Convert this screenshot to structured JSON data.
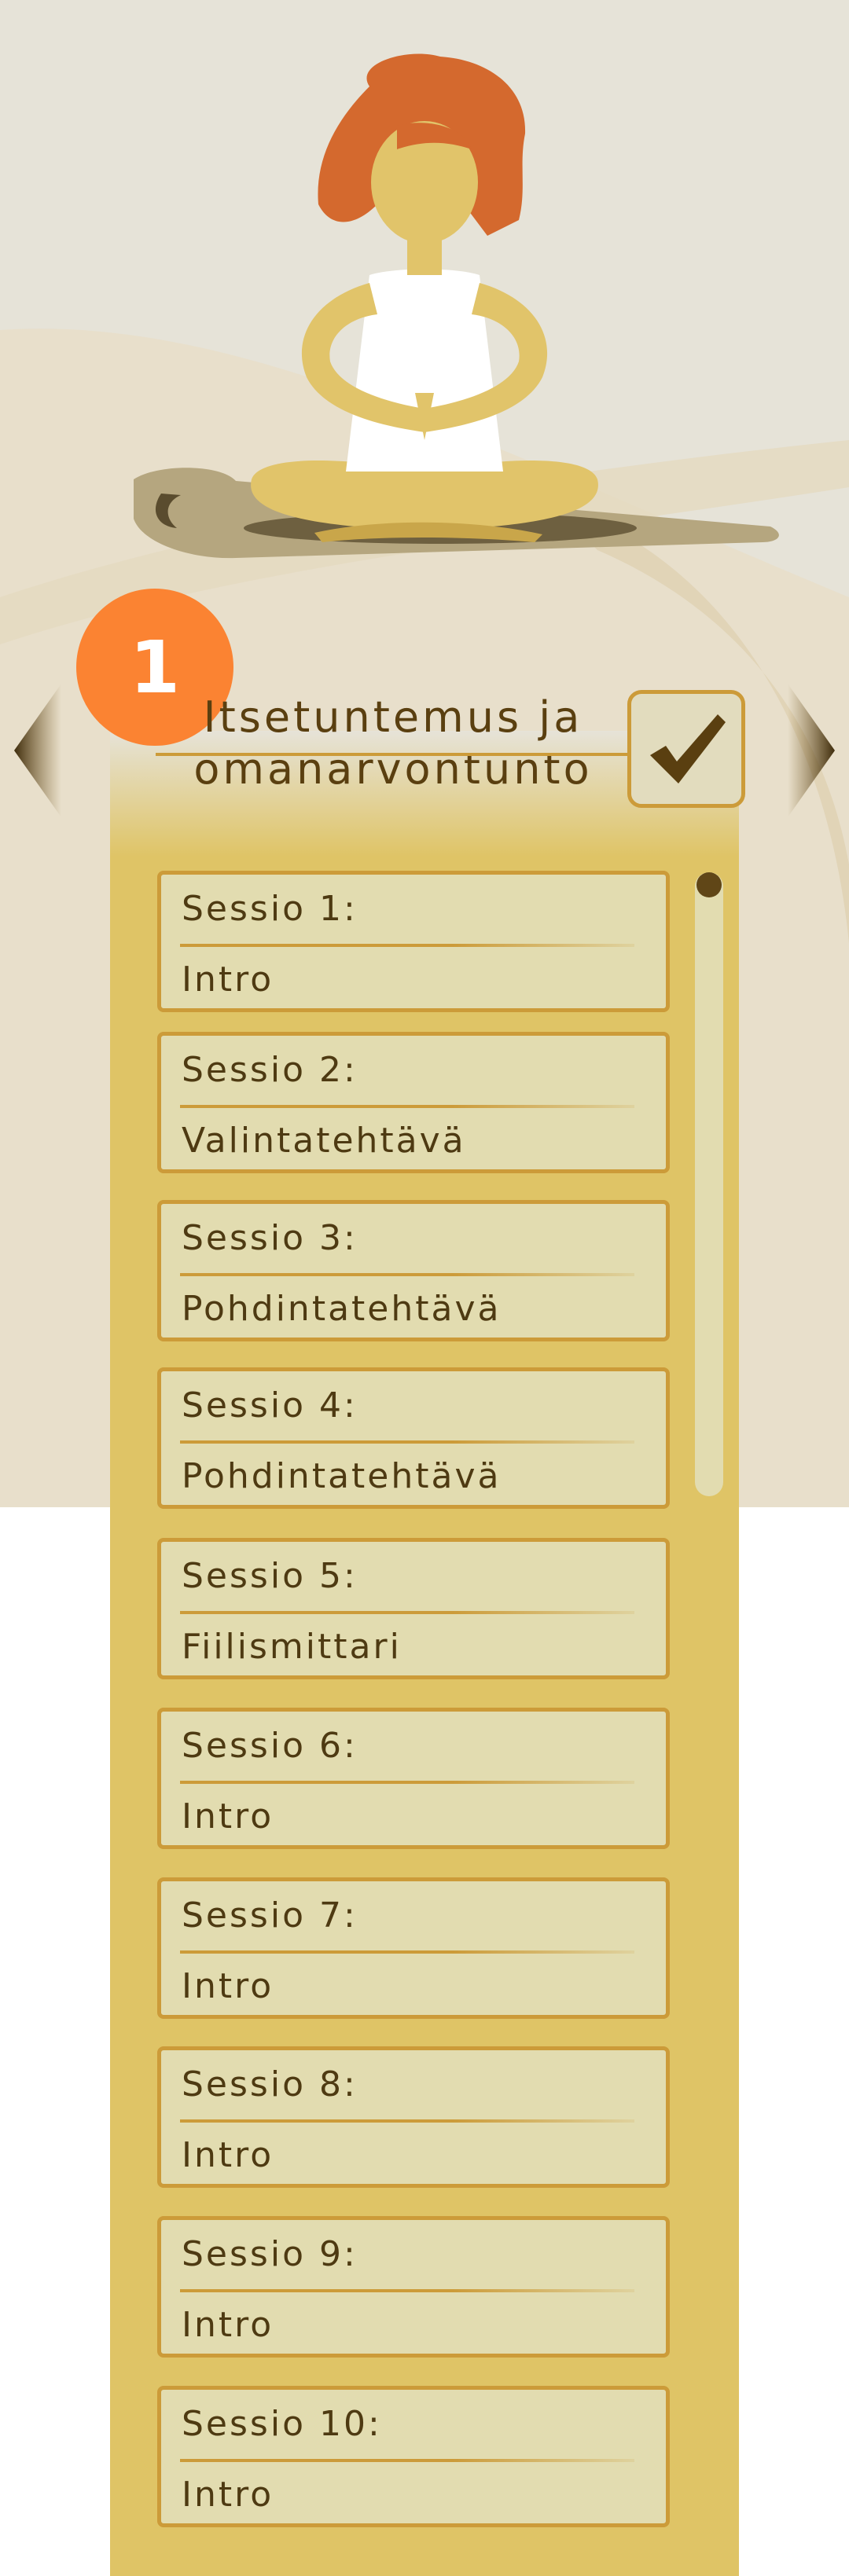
{
  "module": {
    "number": "1",
    "title_line1": "Itsetuntemus ja",
    "title_line2": "omanarvontunto",
    "completed": true,
    "icons": {
      "prev": "chevron-left-icon",
      "next": "chevron-right-icon",
      "check": "checkmark-icon",
      "illustration": "meditating-woman-illustration"
    }
  },
  "colors": {
    "background": "#e6e3d8",
    "panel": "#dfc466",
    "badge": "#fb8332",
    "text": "#4e3a12",
    "card": "#e2dcb0",
    "card_border": "#cc9b39"
  },
  "sessions": [
    {
      "label": "Sessio 1:",
      "activity": "Intro"
    },
    {
      "label": "Sessio 2:",
      "activity": "Valintatehtävä"
    },
    {
      "label": "Sessio 3:",
      "activity": "Pohdintatehtävä"
    },
    {
      "label": "Sessio 4:",
      "activity": "Pohdintatehtävä"
    },
    {
      "label": "Sessio 5:",
      "activity": "Fiilismittari"
    },
    {
      "label": "Sessio 6:",
      "activity": "Intro"
    },
    {
      "label": "Sessio 7:",
      "activity": "Intro"
    },
    {
      "label": "Sessio 8:",
      "activity": "Intro"
    },
    {
      "label": "Sessio 9:",
      "activity": "Intro"
    },
    {
      "label": "Sessio 10:",
      "activity": "Intro"
    }
  ]
}
